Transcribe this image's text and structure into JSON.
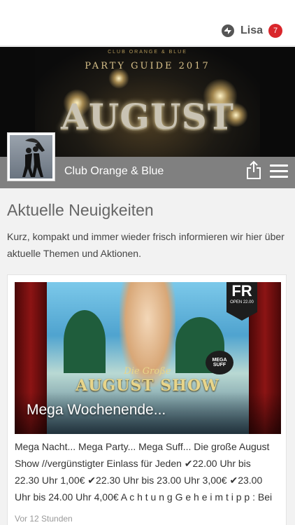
{
  "header": {
    "user_name": "Lisa",
    "notification_count": "7",
    "logo_icon": "app-logo-icon"
  },
  "hero": {
    "subtitle": "CLUB ORANGE & BLUE",
    "guide": "PARTY GUIDE 2017",
    "month": "AUGUST"
  },
  "page": {
    "club_name": "Club Orange & Blue",
    "section_title": "Aktuelle Neuigkeiten",
    "intro": "Kurz, kompakt und immer wieder frisch informieren wir hier über aktuelle Themen und Aktionen."
  },
  "news": [
    {
      "image_title_line1": "Die Große",
      "image_title_line2": "AUGUST SHOW",
      "badge_day": "FR",
      "badge_open": "OPEN 22.00",
      "badge_suff": "MEGA SUFF",
      "overlay_title": "Mega Wochenende...",
      "text": "Mega Nacht... Mega Party... Mega Suff... Die große August Show //vergünstigter Einlass für Jeden ✔22.00 Uhr bis 22.30 Uhr 1,00€ ✔22.30 Uhr bis 23.00 Uhr 3,00€ ✔23.00 Uhr bis 24.00 Uhr 4,00€ A c h t u n g G e h e i m t i p p : Bei",
      "time": "Vor 12 Stunden"
    }
  ],
  "colors": {
    "badge": "#d9262b",
    "titlebar": "#808080",
    "background": "#f2f2f2"
  }
}
